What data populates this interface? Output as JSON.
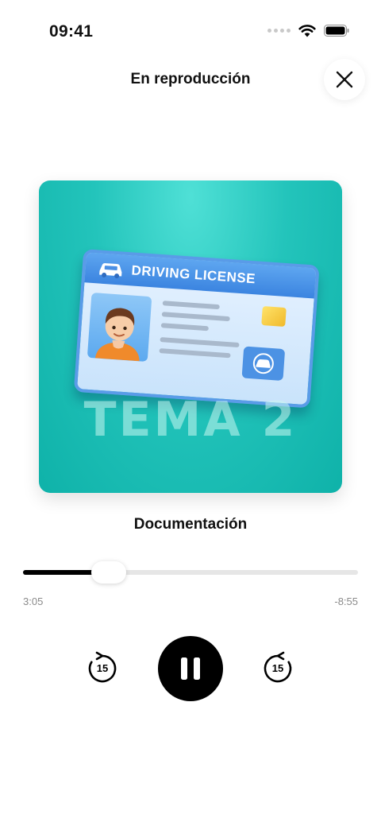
{
  "status_bar": {
    "time": "09:41"
  },
  "header": {
    "title": "En reproducción",
    "close_icon": "close-icon"
  },
  "artwork": {
    "card_label": "DRIVING LICENSE",
    "title": "TEMA 2",
    "background_color": "#1fbfb5"
  },
  "track": {
    "title": "Documentación"
  },
  "progress": {
    "elapsed": "3:05",
    "remaining": "-8:55",
    "fraction": 0.257
  },
  "controls": {
    "skip_back_label": "15",
    "skip_forward_label": "15",
    "skip_back_icon": "rewind-15-icon",
    "skip_forward_icon": "forward-15-icon",
    "play_pause_icon": "pause-icon"
  }
}
